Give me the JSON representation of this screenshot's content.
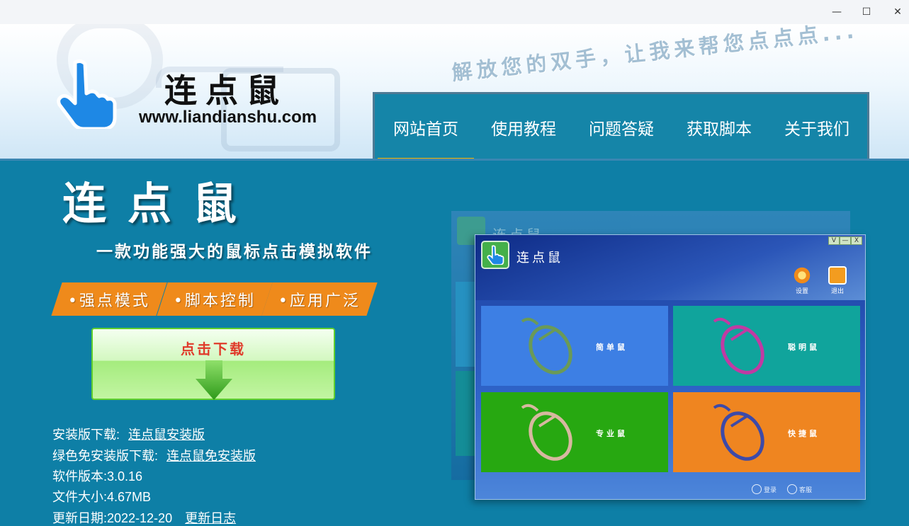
{
  "window": {
    "minimize": "—",
    "maximize": "☐",
    "close": "✕"
  },
  "header": {
    "logo_title": "连点鼠",
    "logo_url": "www.liandianshu.com",
    "slogan": "解放您的双手，让我来帮您点点点..."
  },
  "nav": {
    "items": [
      {
        "label": "网站首页",
        "active": true
      },
      {
        "label": "使用教程"
      },
      {
        "label": "问题答疑"
      },
      {
        "label": "获取脚本"
      },
      {
        "label": "关于我们"
      }
    ]
  },
  "hero": {
    "title": "连点鼠",
    "subtitle": "一款功能强大的鼠标点击模拟软件",
    "features": [
      "•强点模式",
      "•脚本控制",
      "•应用广泛"
    ],
    "download_label": "点击下载"
  },
  "info": {
    "installer_label": "安装版下载:",
    "installer_link": "连点鼠安装版",
    "portable_label": "绿色免安装版下载:",
    "portable_link": "连点鼠免安装版",
    "version": "软件版本:3.0.16",
    "size": "文件大小:4.67MB",
    "date": "更新日期:2022-12-20",
    "changelog_link": "更新日志"
  },
  "preview": {
    "app_title": "连点鼠",
    "back_title": "连点鼠",
    "win_buttons": [
      "V",
      "—",
      "X"
    ],
    "settings_label": "设置",
    "exit_label": "退出",
    "tiles": [
      {
        "label": "简单鼠",
        "color": "#3d7fe4",
        "mouse_color": "#6a9a57"
      },
      {
        "label": "聪明鼠",
        "color": "#10a49c",
        "mouse_color": "#c13aa3"
      },
      {
        "label": "专业鼠",
        "color": "#27a811",
        "mouse_color": "#d7b8a0"
      },
      {
        "label": "快捷鼠",
        "color": "#ef8520",
        "mouse_color": "#3d4aa8"
      }
    ],
    "login_label": "登录",
    "service_label": "客服"
  },
  "colors": {
    "background": "#0e7fa6",
    "nav": "#1585a8",
    "accent": "#f5b400",
    "feature": "#ef8a1b",
    "download_text": "#e03a2a"
  }
}
